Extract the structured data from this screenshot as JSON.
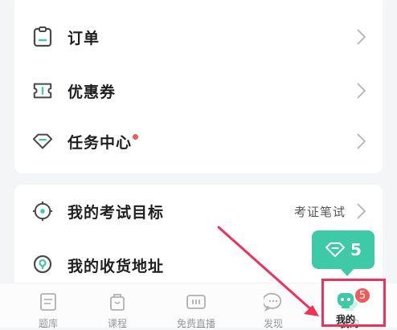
{
  "menu_group_1": [
    {
      "label": "订单",
      "icon": "clipboard-icon"
    },
    {
      "label": "优惠券",
      "icon": "ticket-icon"
    },
    {
      "label": "任务中心",
      "icon": "diamond-icon",
      "has_dot": true
    }
  ],
  "menu_group_2": [
    {
      "label": "我的考试目标",
      "extra": "考证笔试",
      "icon": "target-icon"
    },
    {
      "label": "我的收货地址",
      "icon": "location-pin-icon"
    }
  ],
  "tabbar": [
    {
      "label": "题库",
      "icon": "question-bank-icon"
    },
    {
      "label": "课程",
      "icon": "course-bag-icon"
    },
    {
      "label": "免费直播",
      "icon": "live-tv-icon"
    },
    {
      "label": "发现",
      "icon": "chat-bubble-icon"
    },
    {
      "label": "我的",
      "icon": "robot-avatar-icon",
      "badge": "5"
    }
  ],
  "tooltip": {
    "icon": "diamond-icon",
    "value": "5"
  },
  "colors": {
    "accent": "#3ec9a7",
    "badge": "#f05a5a",
    "highlight": "#f0315a",
    "icon": "#4a4a4a"
  }
}
